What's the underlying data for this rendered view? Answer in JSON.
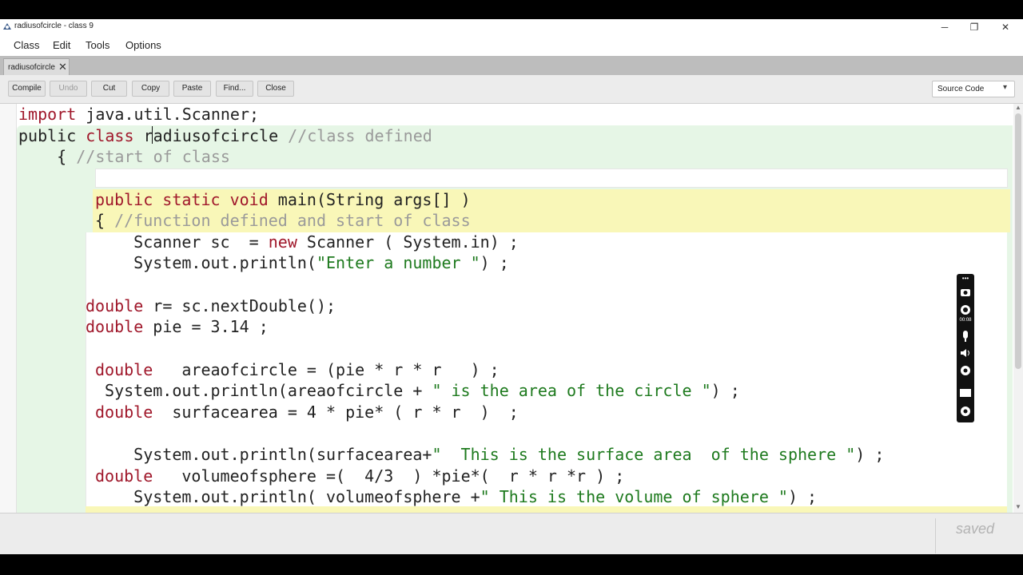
{
  "window": {
    "title": "radiusofcircle - class 9",
    "minimize": "─",
    "maximize": "❐",
    "close": "✕"
  },
  "menu": [
    "Class",
    "Edit",
    "Tools",
    "Options"
  ],
  "tab": {
    "label": "radiusofcircle",
    "close": "✕"
  },
  "toolbar": {
    "buttons": [
      "Compile",
      "Undo",
      "Cut",
      "Copy",
      "Paste",
      "Find...",
      "Close"
    ],
    "disabled": [
      "Undo"
    ],
    "view_mode": "Source Code",
    "view_mode_arrow": "▾"
  },
  "code": {
    "l1": [
      "import",
      " java.util.Scanner;"
    ],
    "l2": [
      "public",
      " ",
      "class",
      " radiusofcircle ",
      "//class defined"
    ],
    "l3": [
      "    { ",
      "//start of class"
    ],
    "l5": [
      "public",
      " ",
      "static",
      " ",
      "void",
      " main(String args[] )"
    ],
    "l6": [
      "{ ",
      "//function defined and start of class"
    ],
    "l7": [
      "    Scanner sc  = ",
      "new",
      " Scanner ( System.in) ;"
    ],
    "l8": [
      "    System.out.println(",
      "\"Enter a number \"",
      ") ;"
    ],
    "l10": [
      "double",
      " r= sc.nextDouble();"
    ],
    "l11": [
      "double",
      " pie = 3.14 ;"
    ],
    "l13": [
      "double",
      "   areaofcircle = (pie * r * r   ) ;"
    ],
    "l14": [
      " System.out.println(areaofcircle + ",
      "\" is the area of the circle \"",
      ") ;"
    ],
    "l15": [
      "double",
      "  surfacearea = 4 * pie* ( r * r  )  ;"
    ],
    "l17": [
      "    System.out.println(surfacearea+",
      "\"  This is the surface area  of the sphere \"",
      ") ;"
    ],
    "l18": [
      "double",
      "   volumeofsphere =(  4/3  ) *pie*(  r * r *r ) ;"
    ],
    "l19": [
      "    System.out.println( volumeofsphere +",
      "\" This is the volume of sphere \"",
      ") ;"
    ]
  },
  "status": {
    "text": "saved"
  },
  "recorder": {
    "time": "00:08"
  },
  "colors": {
    "keyword": "#a0182b",
    "comment": "#9a9a9a",
    "string": "#1e7a1e",
    "class_scope": "#e6f6e6",
    "method_scope": "#f9f7b8"
  },
  "icons": {
    "app": "bluej-icon",
    "recorder": [
      "camera-icon",
      "record-icon",
      "microphone-icon",
      "speaker-icon",
      "webcam-icon",
      "screen-icon",
      "settings-icon"
    ]
  }
}
